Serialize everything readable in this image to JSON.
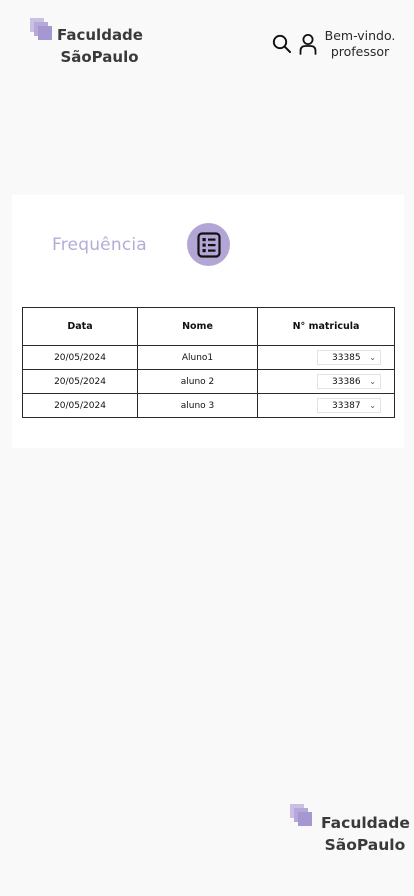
{
  "brand": {
    "line1": "Faculdade",
    "line2": "SãoPaulo",
    "accent_color": "#b3a6d6"
  },
  "header": {
    "search_icon": "search-icon",
    "user_icon": "user-icon",
    "welcome_line1": "Bem-vindo.",
    "welcome_line2": "professor"
  },
  "attendance": {
    "title": "Frequência",
    "icon": "checklist-icon",
    "columns": [
      "Data",
      "Nome",
      "N° matricula"
    ],
    "rows": [
      {
        "date": "20/05/2024",
        "name": "Aluno1",
        "matricula": "33385"
      },
      {
        "date": "20/05/2024",
        "name": "aluno 2",
        "matricula": "33386"
      },
      {
        "date": "20/05/2024",
        "name": "aluno 3",
        "matricula": "33387"
      }
    ]
  },
  "footer": {
    "line1": "Faculdade",
    "line2": "SãoPaulo"
  }
}
